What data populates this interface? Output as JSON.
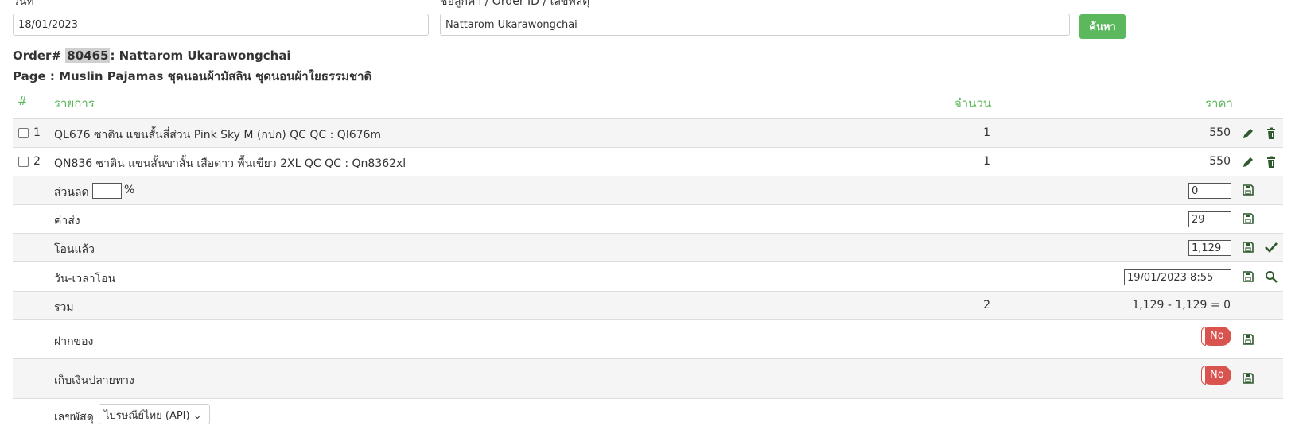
{
  "search": {
    "date_label": "วันที่",
    "date_value": "18/01/2023",
    "customer_label": "ชื่อลูกค้า / Order ID / เลขพัสดุ",
    "customer_value": "Nattarom Ukarawongchai",
    "search_button": "ค้นหา"
  },
  "order": {
    "prefix": "Order#",
    "number": "80465",
    "customer": ": Nattarom Ukarawongchai",
    "page_line": "Page : Muslin Pajamas ชุดนอนผ้ามัสลิน ชุดนอนผ้าใยธรรมชาติ"
  },
  "table": {
    "headers": {
      "index": "#",
      "item": "รายการ",
      "qty": "จำนวน",
      "price": "ราคา"
    },
    "items": [
      {
        "index": "1",
        "name": "QL676 ซาติน แขนสั้นสี่ส่วน Pink Sky M (กปก) QC QC : Ql676m",
        "qty": "1",
        "price": "550"
      },
      {
        "index": "2",
        "name": "QN836 ซาติน แขนสั้นขาสั้น เสือดาว พื้นเขียว 2XL QC QC : Qn8362xl",
        "qty": "1",
        "price": "550"
      }
    ],
    "discount": {
      "label": "ส่วนลด",
      "percent_value": "",
      "percent_sign": "%",
      "amount": "0"
    },
    "shipping": {
      "label": "ค่าส่ง",
      "amount": "29"
    },
    "paid": {
      "label": "โอนแล้ว",
      "amount": "1,129"
    },
    "transfer_time": {
      "label": "วัน-เวลาโอน",
      "value": "19/01/2023 8:55"
    },
    "total": {
      "label": "รวม",
      "qty": "2",
      "summary": "1,129 - 1,129 = 0"
    },
    "deposit": {
      "label": "ฝากของ",
      "toggle": "No"
    },
    "cod": {
      "label": "เก็บเงินปลายทาง",
      "toggle": "No"
    },
    "tracking": {
      "label": "เลขพัสดุ",
      "carrier": "ไปรษณีย์ไทย (API)"
    }
  },
  "colors": {
    "accent": "#5cb85c",
    "danger": "#d9534f",
    "icon": "#2f5a2f"
  }
}
